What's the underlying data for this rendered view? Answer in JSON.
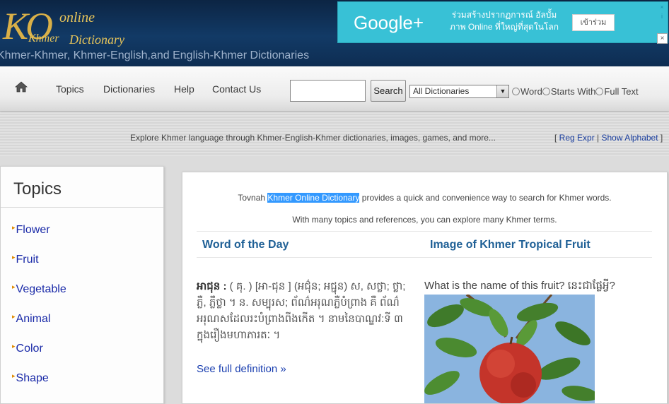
{
  "header": {
    "logo": {
      "k": "KO",
      "online": "online",
      "khmer": "Khmer",
      "dictionary": "Dictionary"
    },
    "tagline": "Khmer-Khmer, Khmer-English,and English-Khmer Dictionaries"
  },
  "ad": {
    "brand": "Google+",
    "text": "ร่วมสร้างปรากฏการณ์ อัลบั้มภาพ Online ที่ใหญ่ที่สุดในโลก",
    "button": "เข้าร่วม",
    "close_label": "×",
    "info_label": "i",
    "close_box_label": "×"
  },
  "nav": {
    "home_icon": "home-icon",
    "items": [
      "Topics",
      "Dictionaries",
      "Help",
      "Contact Us"
    ],
    "search_value": "",
    "search_button": "Search",
    "dictionary_select": "All Dictionaries",
    "select_arrow": "▼",
    "radios": [
      "Word",
      "Starts With",
      "Full Text"
    ]
  },
  "substrip": {
    "explore": "Explore Khmer language through Khmer-English-Khmer dictionaries, images, games, and more...",
    "open_bracket": "[ ",
    "reg_expr": "Reg Expr",
    "separator": " | ",
    "show_alphabet": "Show Alphabet",
    "close_bracket": " ]"
  },
  "sidebar": {
    "title": "Topics",
    "bullet": "▸",
    "items": [
      "Flower",
      "Fruit",
      "Vegetable",
      "Animal",
      "Color",
      "Shape"
    ]
  },
  "main": {
    "intro_before": "Tovnah ",
    "intro_highlight": "Khmer Online Dictionary",
    "intro_after": " provides a quick and convenience way to search for Khmer words.",
    "intro2": "With many topics and references, you can explore many Khmer terms.",
    "word_of_day_heading": "Word of the Day",
    "image_heading": "Image of Khmer Tropical Fruit",
    "word_headword": "អាជុន : ",
    "word_definition": "( គុ. ) [អា-ជុន ] (អជ៌ុន; អជ្ជុន) ស, សថ្លា; ថ្លា; ភ្លឺ, ភ្លឺថ្លា ។ ន. សម្បុរស; ព័ណ៌អរុណភ្លឺបំព្រាង គឺ ព័ណ៌អរុណសដែលរះបំព្រាងពីងកើត ។ នាមនៃបាណ្ឌវ:ទី ៣ ក្នុងរឿងមហាភារតៈ ។",
    "see_full": "See full definition »",
    "fruit_question": "What is the name of this fruit? នេះជាផ្លែអ្វី?"
  },
  "colors": {
    "header_bg": "#123a66",
    "logo_gold": "#d9b048",
    "ad_bg": "#38c1d6",
    "link_blue": "#1a2aa8",
    "heading_blue": "#1f6096",
    "highlight": "#3399ff"
  }
}
